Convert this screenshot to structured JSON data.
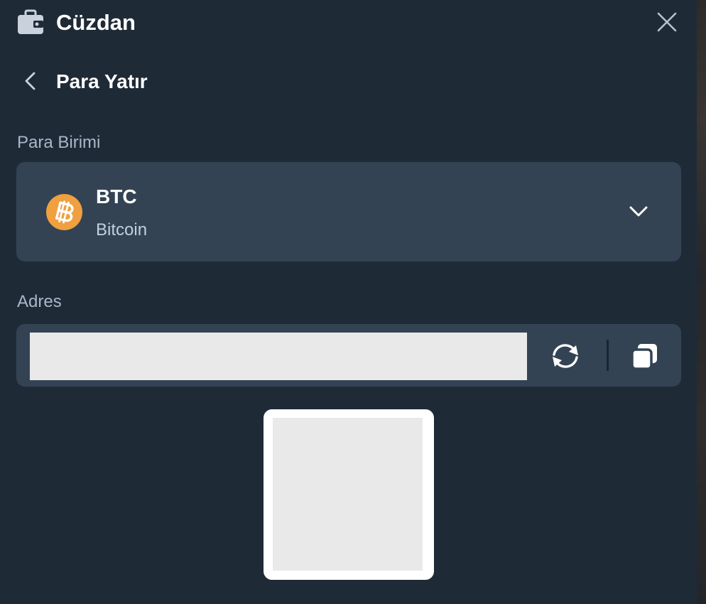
{
  "header": {
    "title": "Cüzdan",
    "wallet_icon": "wallet-icon",
    "close_icon": "close-icon"
  },
  "page": {
    "title": "Para Yatır",
    "back_icon": "chevron-left-icon"
  },
  "currency": {
    "label": "Para Birimi",
    "selected_code": "BTC",
    "selected_name": "Bitcoin",
    "coin_icon": "bitcoin-icon",
    "coin_color": "#f0a03f",
    "dropdown_icon": "chevron-down-icon"
  },
  "address": {
    "label": "Adres",
    "value": "",
    "refresh_icon": "refresh-icon",
    "copy_icon": "copy-icon"
  },
  "qr": {
    "icon": "qr-code"
  },
  "colors": {
    "background": "#1f2a37",
    "card": "#344353",
    "label": "#aab7c8",
    "placeholder_fill": "#e9e9e9"
  }
}
